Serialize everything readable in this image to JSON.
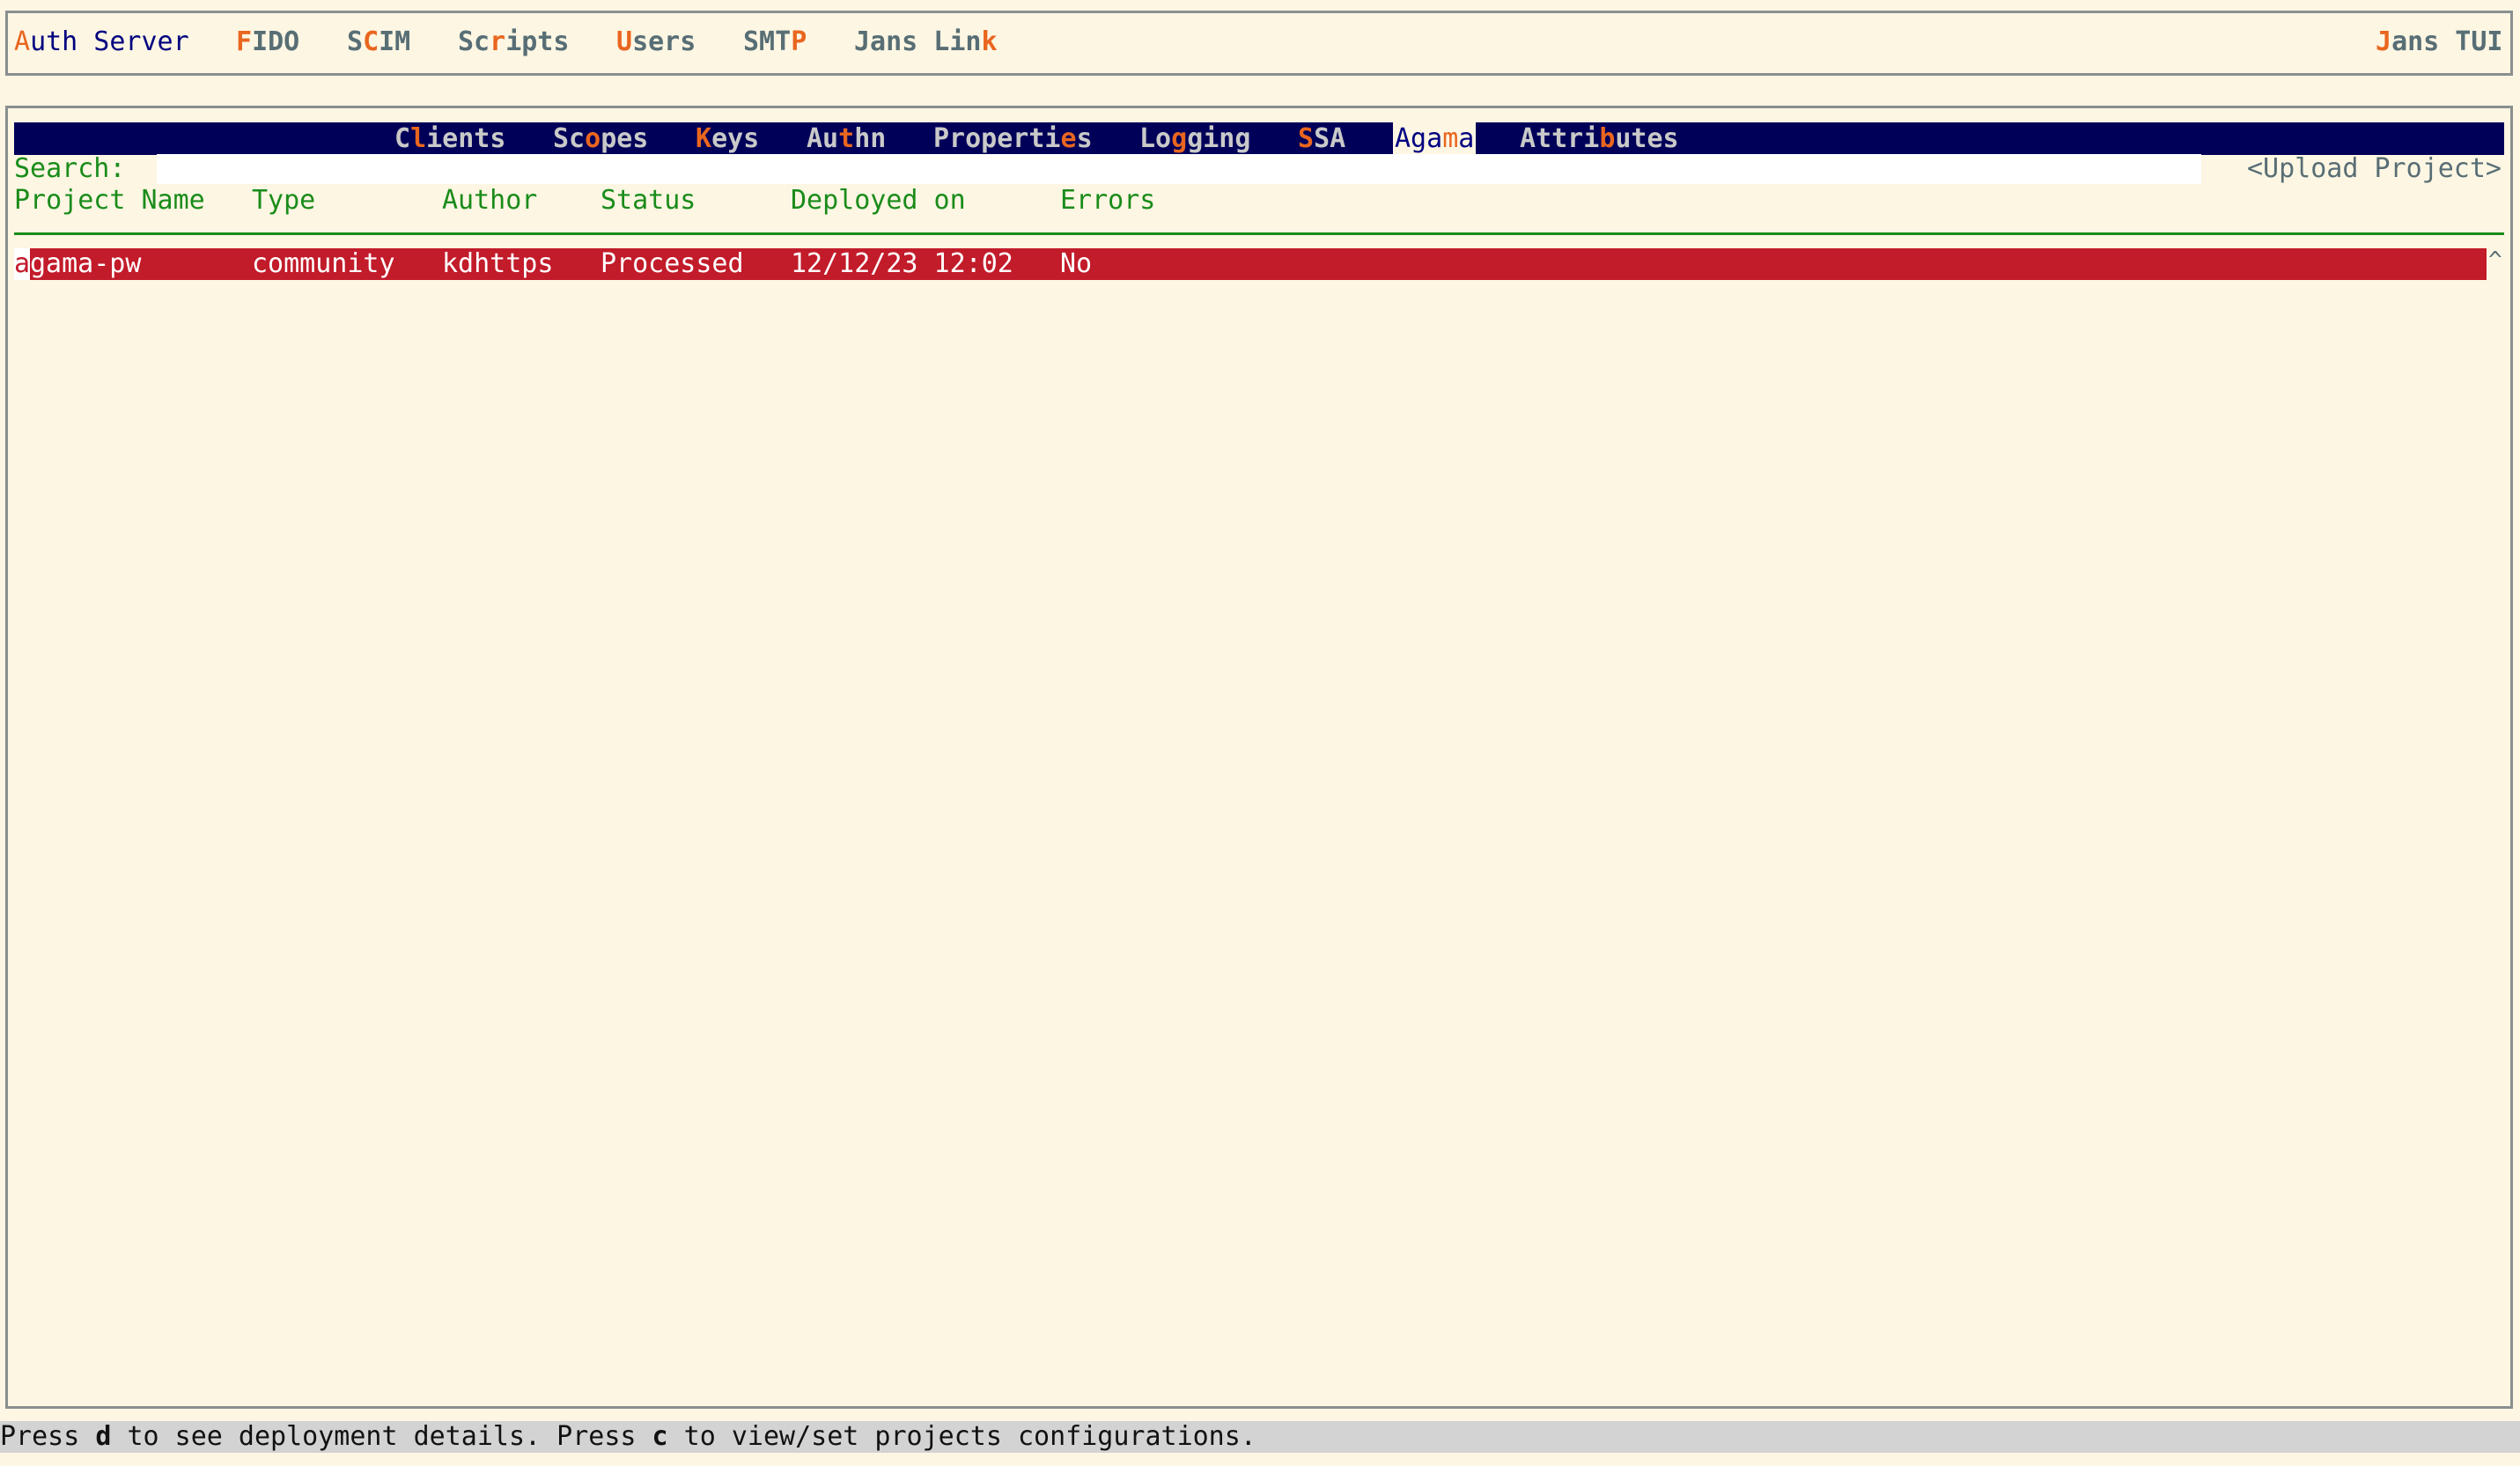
{
  "top_menu": {
    "items": [
      {
        "pre": "",
        "hk": "A",
        "post": "uth Server",
        "active": true
      },
      {
        "pre": "",
        "hk": "F",
        "post": "IDO",
        "active": false
      },
      {
        "pre": "S",
        "hk": "C",
        "post": "IM",
        "active": false
      },
      {
        "pre": "Sc",
        "hk": "r",
        "post": "ipts",
        "active": false
      },
      {
        "pre": "",
        "hk": "U",
        "post": "sers",
        "active": false
      },
      {
        "pre": "SMT",
        "hk": "P",
        "post": "",
        "active": false
      },
      {
        "pre": "Jans Lin",
        "hk": "k",
        "post": "",
        "active": false
      }
    ],
    "app_title": {
      "pre": "",
      "hk": "J",
      "post": "ans TUI"
    }
  },
  "tabs": [
    {
      "pre": "C",
      "hk": "l",
      "post": "ients",
      "active": false
    },
    {
      "pre": "Sc",
      "hk": "o",
      "post": "pes",
      "active": false
    },
    {
      "pre": "",
      "hk": "K",
      "post": "eys",
      "active": false
    },
    {
      "pre": "Au",
      "hk": "t",
      "post": "hn",
      "active": false
    },
    {
      "pre": "Properti",
      "hk": "e",
      "post": "s",
      "active": false
    },
    {
      "pre": "Lo",
      "hk": "g",
      "post": "ging",
      "active": false
    },
    {
      "pre": "",
      "hk": "S",
      "post": "SA",
      "active": false
    },
    {
      "pre": "Aga",
      "hk": "m",
      "post": "a",
      "active": true
    },
    {
      "pre": "Attri",
      "hk": "b",
      "post": "utes",
      "active": false
    }
  ],
  "search": {
    "label": "Search:",
    "value": ""
  },
  "upload_button": "<Upload Project>",
  "table": {
    "headers": [
      "Project Name",
      "Type",
      "Author",
      "Status",
      "Deployed on",
      "Errors"
    ],
    "rows": [
      {
        "cursor": "a",
        "name_rest": "gama-pw",
        "type": "community",
        "author": "kdhttps",
        "status": "Processed",
        "deployed_on": "12/12/23 12:02",
        "errors": "No"
      }
    ]
  },
  "scroll_indicator": "^",
  "status_bar": {
    "p1": "Press ",
    "k1": "d",
    "p2": " to see deployment details. Press ",
    "k2": "c",
    "p3": " to view/set projects configurations."
  },
  "colors": {
    "background": "#fdf6e3",
    "navy": "#000080",
    "hotkey": "#e9661f",
    "green": "#1a8c1a",
    "selected_row": "#c21b2a",
    "status_bar": "#d3d3d3"
  }
}
